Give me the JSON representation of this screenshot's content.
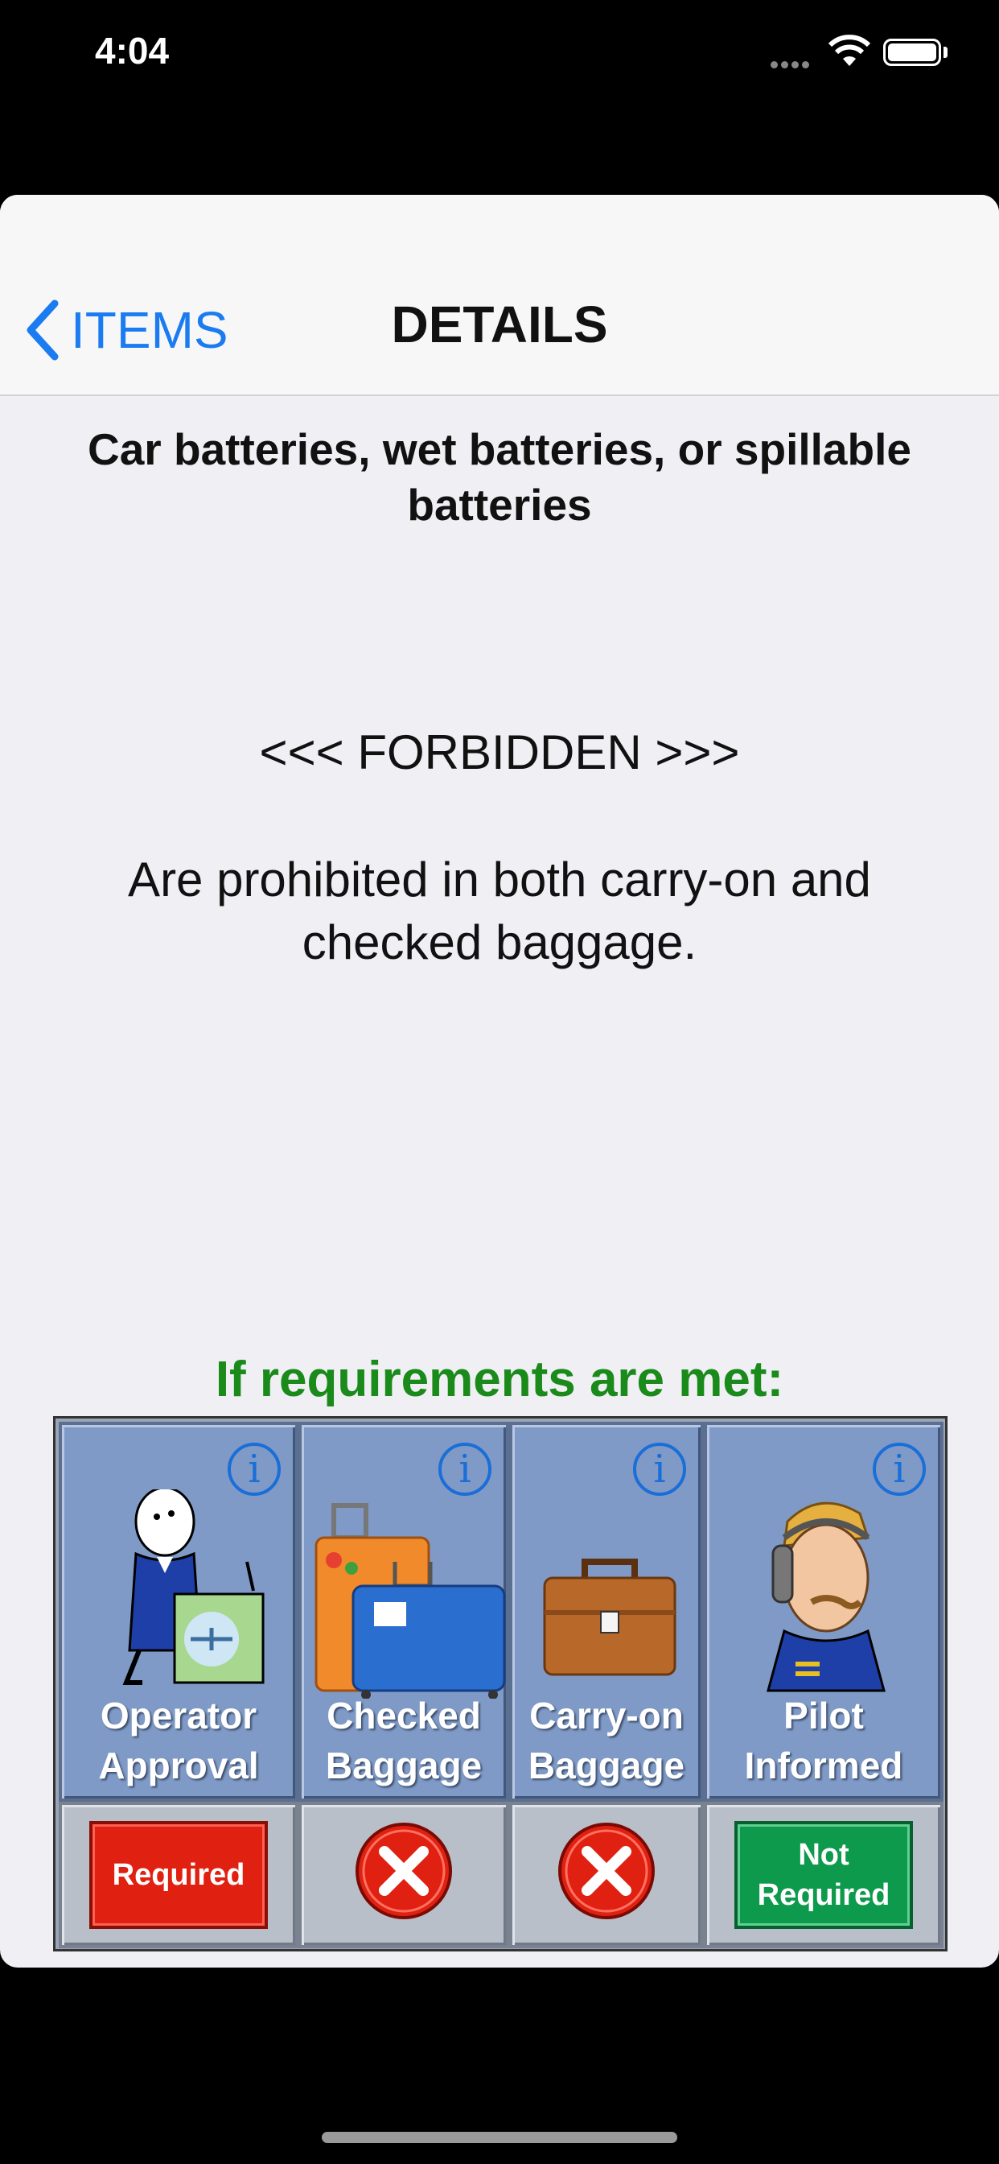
{
  "status_bar": {
    "time": "4:04"
  },
  "nav": {
    "back_label": "ITEMS",
    "title": "DETAILS"
  },
  "item": {
    "title": "Car batteries, wet batteries, or spillable batteries",
    "status": "<<< FORBIDDEN >>>",
    "description": "Are prohibited in both carry-on and checked baggage."
  },
  "requirements": {
    "heading": "If requirements are met:",
    "columns": [
      {
        "label_line1": "Operator",
        "label_line2": "Approval",
        "status": "Required"
      },
      {
        "label_line1": "Checked",
        "label_line2": "Baggage",
        "status": "not-allowed-icon"
      },
      {
        "label_line1": "Carry-on",
        "label_line2": "Baggage",
        "status": "not-allowed-icon"
      },
      {
        "label_line1": "Pilot",
        "label_line2": "Informed",
        "status_line1": "Not",
        "status_line2": "Required"
      }
    ],
    "info_glyph": "i"
  },
  "colors": {
    "accent": "#1a7cf0",
    "heading_green": "#1a8a1a",
    "required_red": "#e02010",
    "not_required_green": "#0e9a4c"
  }
}
